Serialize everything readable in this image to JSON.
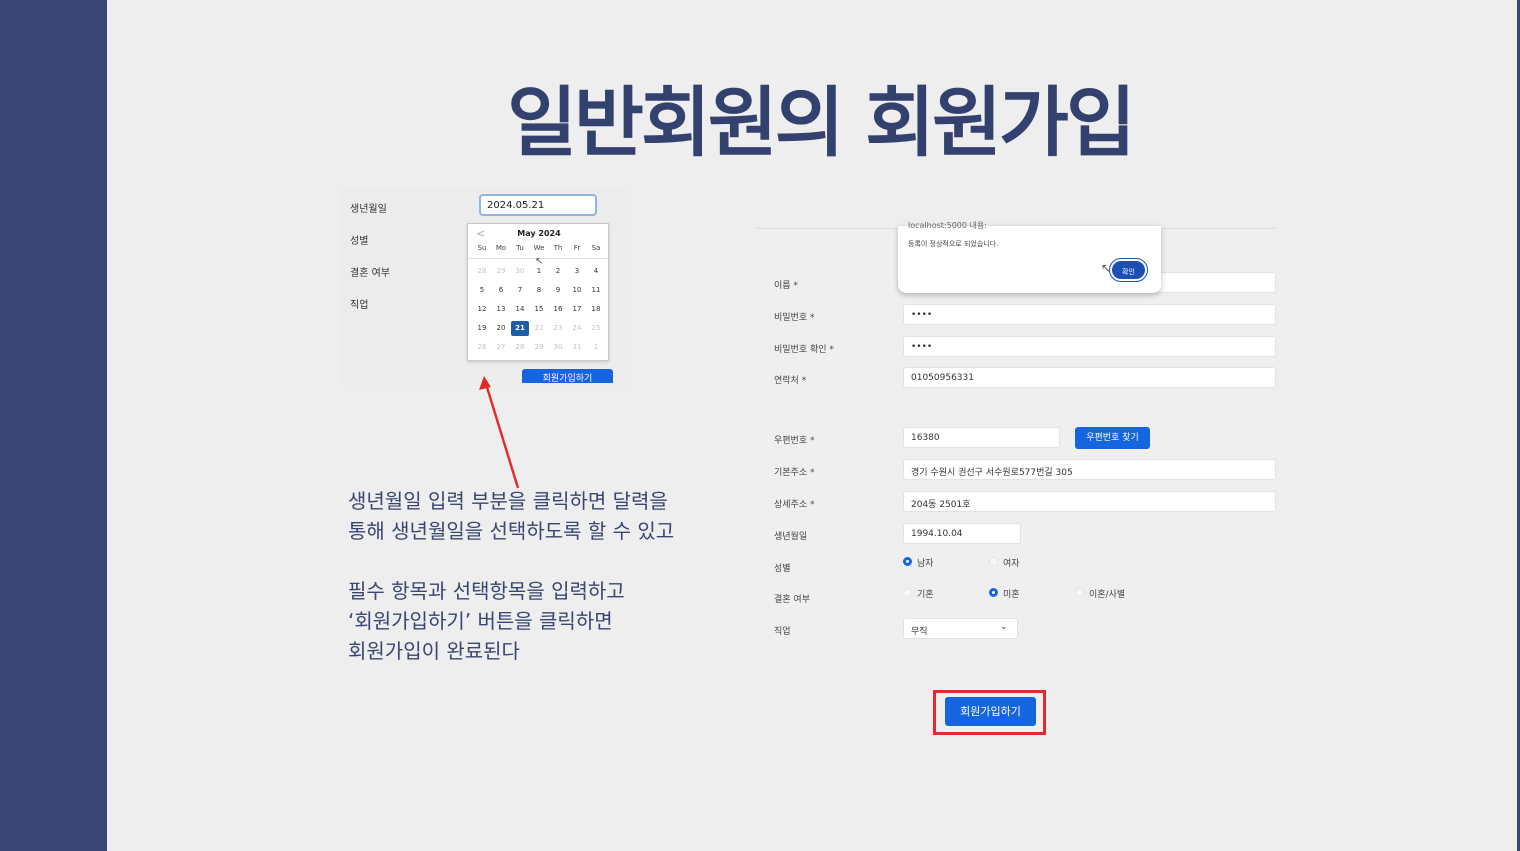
{
  "slide": {
    "title": "일반회원의 회원가입"
  },
  "left_form": {
    "labels": {
      "birth": "생년월일",
      "gender": "성별",
      "marriage": "결혼 여부",
      "job": "직업"
    },
    "birth_value": "2024.05.21",
    "submit_label": "회원가입하기"
  },
  "calendar": {
    "title": "May 2024",
    "prev": "<",
    "weekdays": [
      "Su",
      "Mo",
      "Tu",
      "We",
      "Th",
      "Fr",
      "Sa"
    ],
    "weeks": [
      [
        "28",
        "29",
        "30",
        "1",
        "2",
        "3",
        "4"
      ],
      [
        "5",
        "6",
        "7",
        "8",
        "9",
        "10",
        "11"
      ],
      [
        "12",
        "13",
        "14",
        "15",
        "16",
        "17",
        "18"
      ],
      [
        "19",
        "20",
        "21",
        "22",
        "23",
        "24",
        "25"
      ],
      [
        "26",
        "27",
        "28",
        "29",
        "30",
        "31",
        "1"
      ]
    ],
    "selected": "21"
  },
  "description": {
    "line1": "생년월일 입력 부분을 클릭하면 달력을",
    "line2": "통해 생년월일을 선택하도록 할 수 있고",
    "line3": "필수 항목과 선택항목을 입력하고",
    "line4": "‘회원가입하기’ 버튼을 클릭하면",
    "line5": "회원가입이 완료된다"
  },
  "alert": {
    "top_text": "localhost:5000 내용:",
    "message": "등록이 정상적으로 되었습니다.",
    "ok_label": "확인"
  },
  "right_form": {
    "labels": {
      "name": "이름 *",
      "password": "비밀번호 *",
      "password_confirm": "비밀번호 확인 *",
      "phone": "연락처 *",
      "zipcode": "우편번호 *",
      "address": "기본주소 *",
      "address_detail": "상세주소 *",
      "birth": "생년월일",
      "gender": "성별",
      "marriage": "결혼 여부",
      "job": "직업"
    },
    "values": {
      "password": "••••",
      "password_confirm": "••••",
      "phone": "01050956331",
      "zipcode": "16380",
      "address": "경기 수원시 권선구 서수원로577번길 305",
      "address_detail": "204동 2501호",
      "birth": "1994.10.04",
      "job": "무직"
    },
    "zip_button": "우편번호 찾기",
    "gender_options": {
      "male": "남자",
      "female": "여자"
    },
    "gender_selected": "남자",
    "marriage_options": {
      "married": "기혼",
      "single": "미혼",
      "divorced": "이혼/사별"
    },
    "marriage_selected": "미혼",
    "submit_label": "회원가입하기"
  },
  "colors": {
    "sidebar": "#3a4674",
    "title": "#33416e",
    "button": "#1565e0",
    "highlight": "#e32a2a"
  }
}
